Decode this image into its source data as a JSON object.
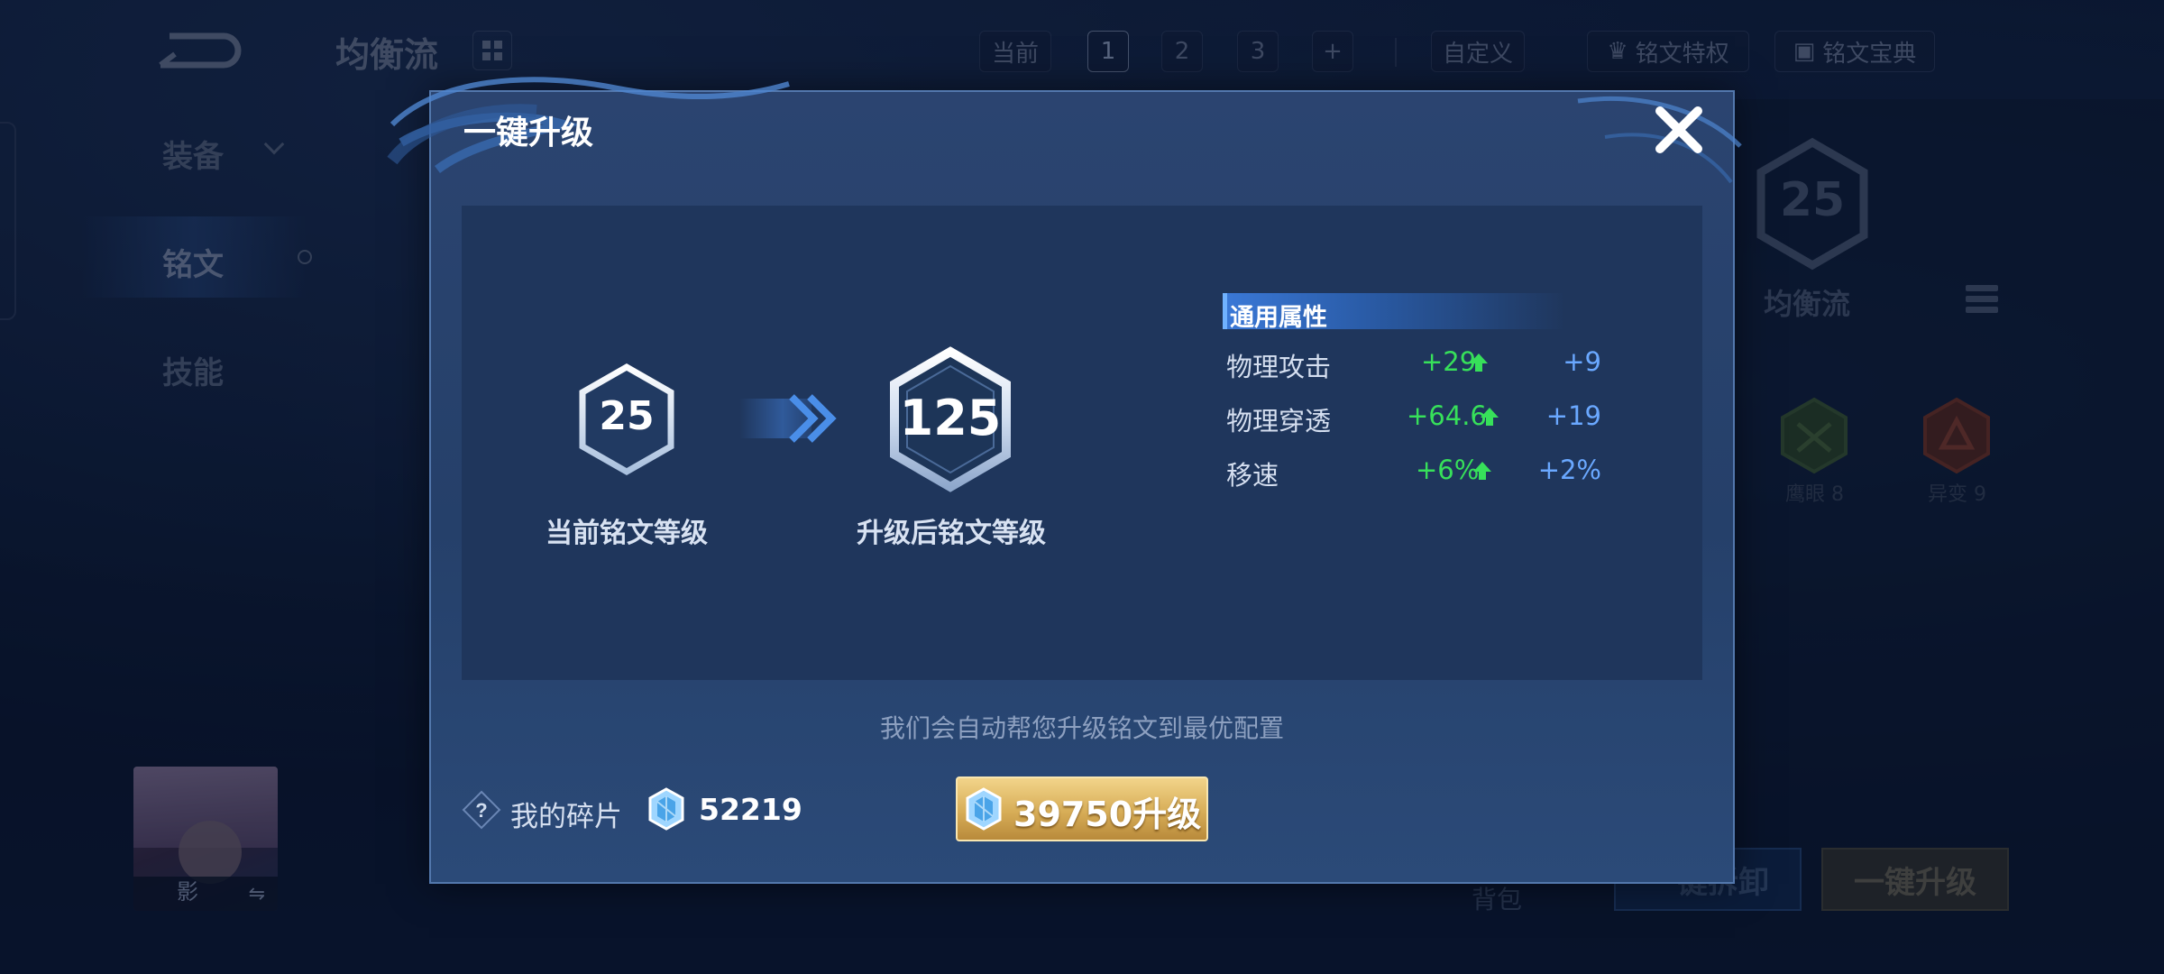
{
  "background": {
    "title": "均衡流",
    "page_tabs": {
      "current_label": "当前",
      "pages": [
        "1",
        "2",
        "3"
      ],
      "add_label": "+",
      "custom_label": "自定义"
    },
    "privilege_label": "铭文特权",
    "handbook_label": "铭文宝典",
    "side_menu": {
      "equipment": "装备",
      "rune": "铭文",
      "skill": "技能"
    },
    "hero_name": "影",
    "swap_symbol": "⇋",
    "backpack_label": "背包",
    "right_panel": {
      "level": "25",
      "preset_name": "均衡流",
      "runes": [
        {
          "label": "鹰眼 8"
        },
        {
          "label": "异变 9"
        }
      ],
      "unload_label": "一键拆卸",
      "upgrade_label": "一键升级"
    }
  },
  "modal": {
    "title": "一键升级",
    "current_level": "25",
    "current_level_label": "当前铭文等级",
    "upgraded_level": "125",
    "upgraded_level_label": "升级后铭文等级",
    "attributes_header": "通用属性",
    "attributes": [
      {
        "name": "物理攻击",
        "delta": "+29",
        "total": "+9"
      },
      {
        "name": "物理穿透",
        "delta": "+64.6",
        "total": "+19"
      },
      {
        "name": "移速",
        "delta": "+6%",
        "total": "+2%"
      }
    ],
    "tip": "我们会自动帮您升级铭文到最优配置",
    "my_shards_label": "我的碎片",
    "my_shards_value": "52219",
    "upgrade_button_label": "39750升级"
  },
  "colors": {
    "delta_green": "#37e05a",
    "total_blue": "#6aa8ff",
    "gold_button": "#d7ad57",
    "modal_bg": "#2b4470"
  },
  "icons": {
    "close": "close-icon",
    "help": "question-icon",
    "shard": "crystal-icon",
    "arrow": "double-chevron-right-icon",
    "up": "up-arrow-icon"
  }
}
